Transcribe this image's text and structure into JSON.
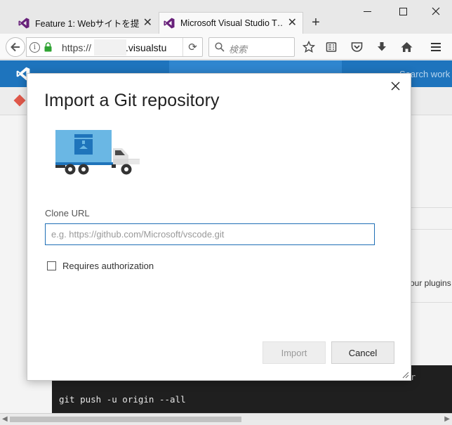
{
  "browser": {
    "tabs": [
      {
        "label": "Feature 1: Webサイトを提…",
        "icon": "visual-studio-icon"
      },
      {
        "label": "Microsoft Visual Studio T…",
        "icon": "visual-studio-icon"
      }
    ],
    "new_tab_symbol": "+",
    "close_symbol": "✕",
    "address": {
      "scheme": "https://",
      "host": ".visualstu"
    },
    "search_placeholder": "検索",
    "window_controls": [
      "minimize-icon",
      "maximize-icon",
      "close-icon"
    ],
    "toolbar_icons": [
      "bookmark-star-icon",
      "reading-list-icon",
      "pocket-icon",
      "download-icon",
      "home-icon",
      "menu-icon"
    ]
  },
  "page": {
    "search_text": "Search work",
    "plugins_text": "our plugins",
    "terminal_line": "git push -u origin --all",
    "terminal_right": "r"
  },
  "dialog": {
    "title": "Import a Git repository",
    "clone_url_label": "Clone URL",
    "clone_url_placeholder": "e.g. https://github.com/Microsoft/vscode.git",
    "requires_auth_label": "Requires authorization",
    "import_label": "Import",
    "cancel_label": "Cancel"
  },
  "colors": {
    "vsts_blue": "#1e74bd",
    "input_border": "#1f6fb6",
    "truck_body": "#6ab7e4",
    "truck_box_dark": "#1f74bb"
  }
}
